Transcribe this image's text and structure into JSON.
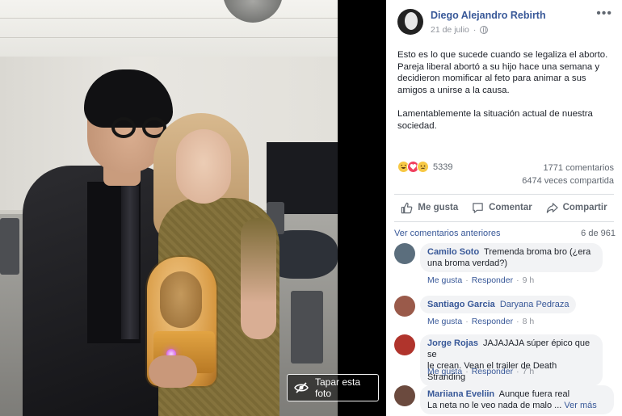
{
  "photo": {
    "tag_label": "Tapar esta foto"
  },
  "post": {
    "author": "Diego Alejandro Rebirth",
    "date": "21 de julio",
    "date_separator": "·",
    "more_label": "•••",
    "paragraph1": "Esto es lo que sucede cuando se legaliza el aborto. Pareja liberal abortó a su hijo hace una semana y decidieron momificar al feto para animar a sus amigos a unirse a la causa.",
    "paragraph2": "Lamentablemente la situación actual de nuestra sociedad."
  },
  "stats": {
    "reactions_count": "5339",
    "reaction_types": [
      "haha",
      "love",
      "sad"
    ],
    "comments": "1771 comentarios",
    "shares": "6474 veces compartida"
  },
  "actions": {
    "like": "Me gusta",
    "comment": "Comentar",
    "share": "Compartir"
  },
  "comments_section": {
    "prev_label": "Ver comentarios anteriores",
    "count": "6 de 961",
    "items": [
      {
        "name": "Camilo Soto",
        "text_line1": "Tremenda broma bro (¿era",
        "text_line2": "una broma verdad?)",
        "like": "Me gusta",
        "reply": "Responder",
        "time": "9 h",
        "avatar_color": "#5b6e7d"
      },
      {
        "name": "Santiago Garcia",
        "mention": "Daryana Pedraza",
        "like": "Me gusta",
        "reply": "Responder",
        "time": "8 h",
        "avatar_color": "#9a5a4a"
      },
      {
        "name": "Jorge Rojas",
        "text_line1": "JAJAJAJA súper épico que se",
        "text_line2": "le crean. Vean el trailer de Death Stranding",
        "like": "Me gusta",
        "reply": "Responder",
        "time": "7 h",
        "avatar_color": "#b0342c"
      },
      {
        "name": "Mariiana Eveliin",
        "text_line1": "Aunque fuera real",
        "text_line2": "La neta no le veo nada de malo ...",
        "see_more": "Ver más",
        "avatar_color": "#6b4a3e"
      }
    ]
  },
  "colors": {
    "link_blue": "#385898",
    "muted_gray": "#606770",
    "bubble_gray": "#f2f3f5"
  }
}
